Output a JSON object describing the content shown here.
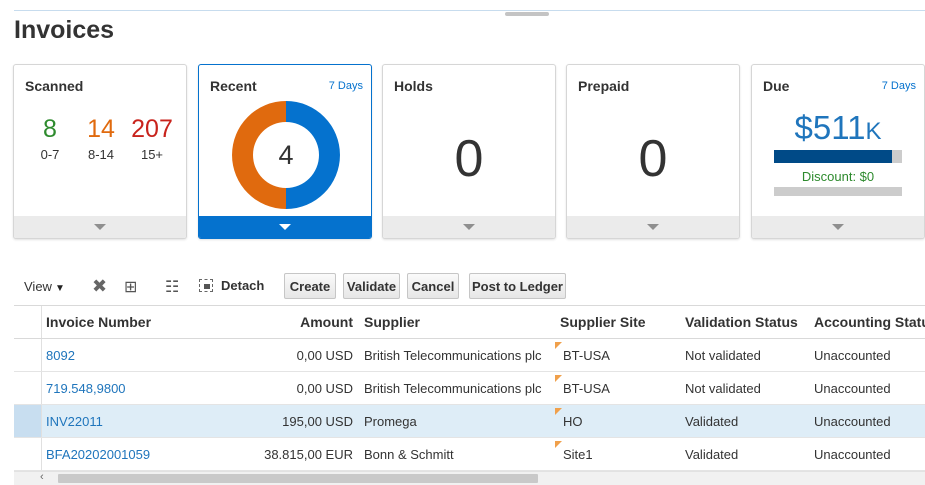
{
  "page": {
    "title": "Invoices"
  },
  "tiles": {
    "scanned": {
      "title": "Scanned",
      "buckets": [
        {
          "count": "8",
          "label": "0-7",
          "color": "#2e8b2e"
        },
        {
          "count": "14",
          "label": "8-14",
          "color": "#e06a0e"
        },
        {
          "count": "207",
          "label": "15+",
          "color": "#c8231c"
        }
      ]
    },
    "recent": {
      "title": "Recent",
      "period": "7 Days",
      "count": "4",
      "donut": [
        {
          "fraction": 0.5,
          "color": "#0572ce"
        },
        {
          "fraction": 0.5,
          "color": "#e06a0e"
        }
      ]
    },
    "holds": {
      "title": "Holds",
      "count": "0"
    },
    "prepaid": {
      "title": "Prepaid",
      "count": "0"
    },
    "due": {
      "title": "Due",
      "period": "7 Days",
      "amount": "$511",
      "amount_suffix": "K",
      "bar_fraction": 0.92,
      "discount": "Discount: $0"
    }
  },
  "toolbar": {
    "view_label": "View",
    "detach_label": "Detach",
    "create_label": "Create",
    "validate_label": "Validate",
    "cancel_label": "Cancel",
    "post_label": "Post to Ledger"
  },
  "table": {
    "headers": {
      "invoice_number": "Invoice Number",
      "amount": "Amount",
      "supplier": "Supplier",
      "supplier_site": "Supplier Site",
      "validation_status": "Validation Status",
      "accounting_status": "Accounting Status"
    },
    "rows": [
      {
        "invoice_number": "8092",
        "amount": "0,00 USD",
        "supplier": "British Telecommunications plc",
        "supplier_site": "BT-USA",
        "validation_status": "Not validated",
        "accounting_status": "Unaccounted"
      },
      {
        "invoice_number": "719.548,9800",
        "amount": "0,00 USD",
        "supplier": "British Telecommunications plc",
        "supplier_site": "BT-USA",
        "validation_status": "Not validated",
        "accounting_status": "Unaccounted"
      },
      {
        "invoice_number": "INV22011",
        "amount": "195,00 USD",
        "supplier": "Promega",
        "supplier_site": "HO",
        "validation_status": "Validated",
        "accounting_status": "Unaccounted"
      },
      {
        "invoice_number": "BFA20202001059",
        "amount": "38.815,00 EUR",
        "supplier": "Bonn & Schmitt",
        "supplier_site": "Site1",
        "validation_status": "Validated",
        "accounting_status": "Unaccounted"
      }
    ]
  }
}
